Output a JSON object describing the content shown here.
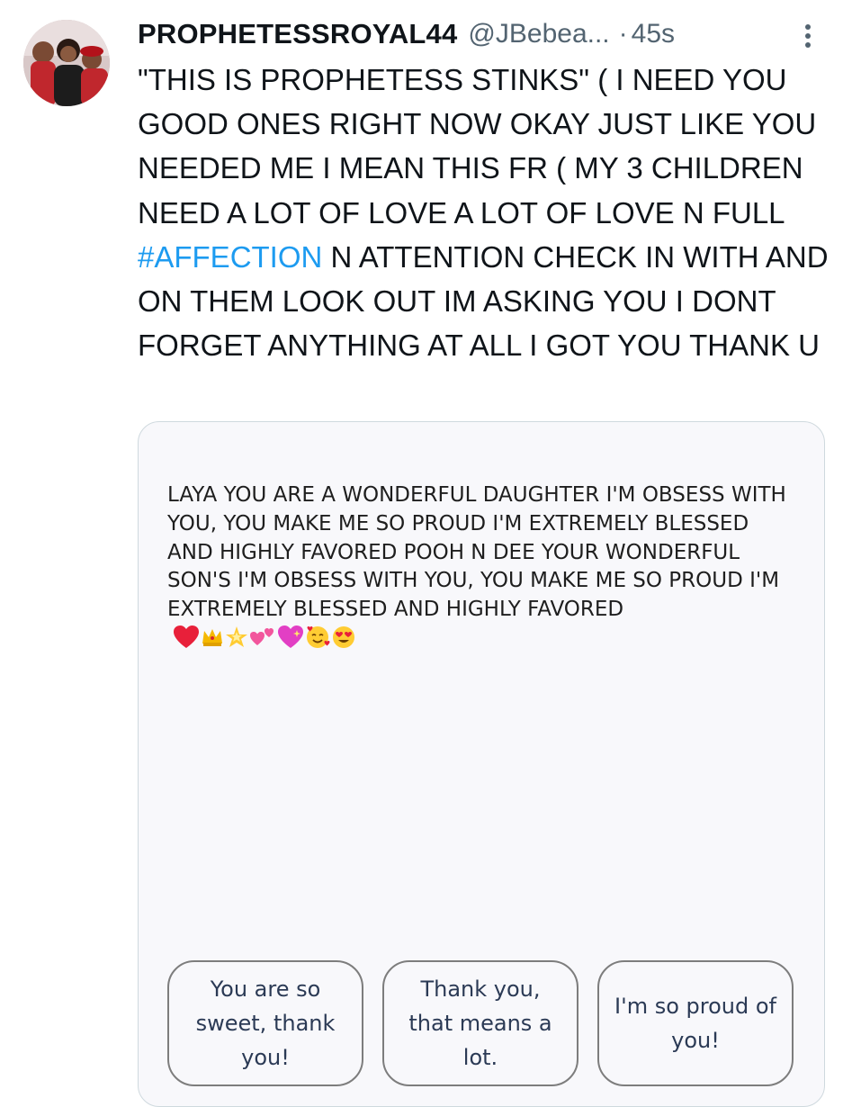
{
  "tweet": {
    "display_name": "PROPHETESSROYAL44",
    "handle": "@JBebea...",
    "separator": "·",
    "time": "45s",
    "more_icon": "more-vertical-icon",
    "text_before_hashtag": "\"THIS IS PROPHETESS STINKS\" ( I NEED YOU GOOD ONES RIGHT NOW OKAY JUST LIKE YOU NEEDED ME I MEAN THIS FR ( MY 3 CHILDREN NEED A LOT OF LOVE A LOT OF LOVE N FULL ",
    "hashtag": "#AFFECTION",
    "text_after_hashtag": " N ATTENTION CHECK IN WITH AND ON THEM LOOK OUT IM ASKING YOU I DONT FORGET ANYTHING AT ALL I GOT YOU THANK U"
  },
  "media": {
    "message": "LAYA YOU ARE A WONDERFUL DAUGHTER I'M OBSESS WITH YOU, YOU MAKE ME SO PROUD I'M EXTREMELY BLESSED AND HIGHLY FAVORED POOH N DEE YOUR WONDERFUL SON'S I'M OBSESS WITH YOU, YOU MAKE ME SO PROUD I'M EXTREMELY BLESSED AND HIGHLY FAVORED",
    "emojis": [
      "red-heart-emoji",
      "crown-emoji",
      "glowing-star-emoji",
      "two-hearts-emoji",
      "sparkling-heart-emoji",
      "smiling-face-with-hearts-emoji",
      "heart-eyes-emoji"
    ],
    "replies": [
      "You are so sweet, thank you!",
      "Thank you, that means a lot.",
      "I'm so proud of you!"
    ]
  },
  "colors": {
    "hashtag": "#1d9bf0",
    "secondary_text": "#536471",
    "reply_text": "#2b3a55"
  }
}
